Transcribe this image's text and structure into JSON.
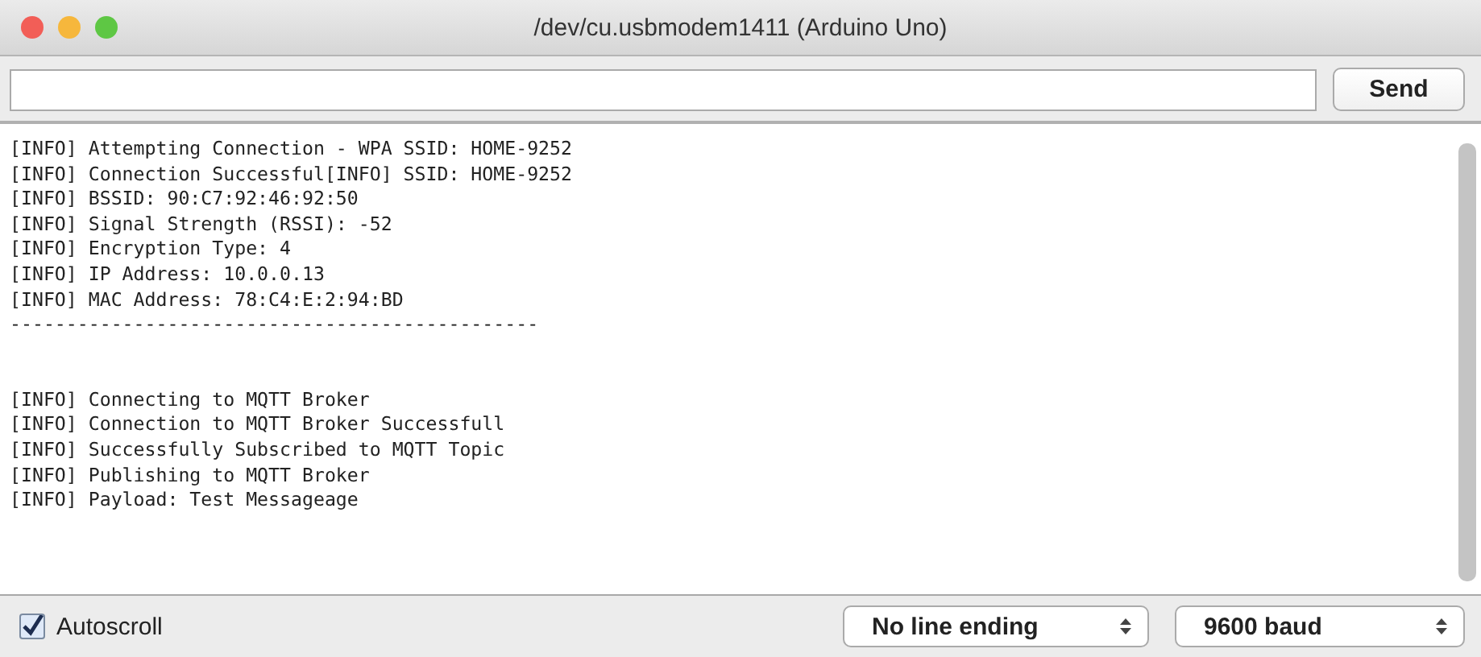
{
  "window": {
    "title": "/dev/cu.usbmodem1411 (Arduino Uno)"
  },
  "input": {
    "button": "Send"
  },
  "output": {
    "blocks": [
      [
        "[INFO] Attempting Connection - WPA SSID: HOME-9252",
        "[INFO] Connection Successful[INFO] SSID: HOME-9252",
        "[INFO] BSSID: 90:C7:92:46:92:50",
        "[INFO] Signal Strength (RSSI): -52",
        "[INFO] Encryption Type: 4",
        "[INFO] IP Address: 10.0.0.13",
        "[INFO] MAC Address: 78:C4:E:2:94:BD",
        "-----------------------------------------------"
      ],
      [
        "[INFO] Connecting to MQTT Broker",
        "[INFO] Connection to MQTT Broker Successfull",
        "[INFO] Successfully Subscribed to MQTT Topic",
        "[INFO] Publishing to MQTT Broker",
        "[INFO] Payload: Test Messageage"
      ]
    ]
  },
  "footer": {
    "autoscroll": {
      "label": "Autoscroll",
      "checked": true
    },
    "selects": [
      {
        "value": "No line ending"
      },
      {
        "value": "9600 baud"
      }
    ]
  }
}
